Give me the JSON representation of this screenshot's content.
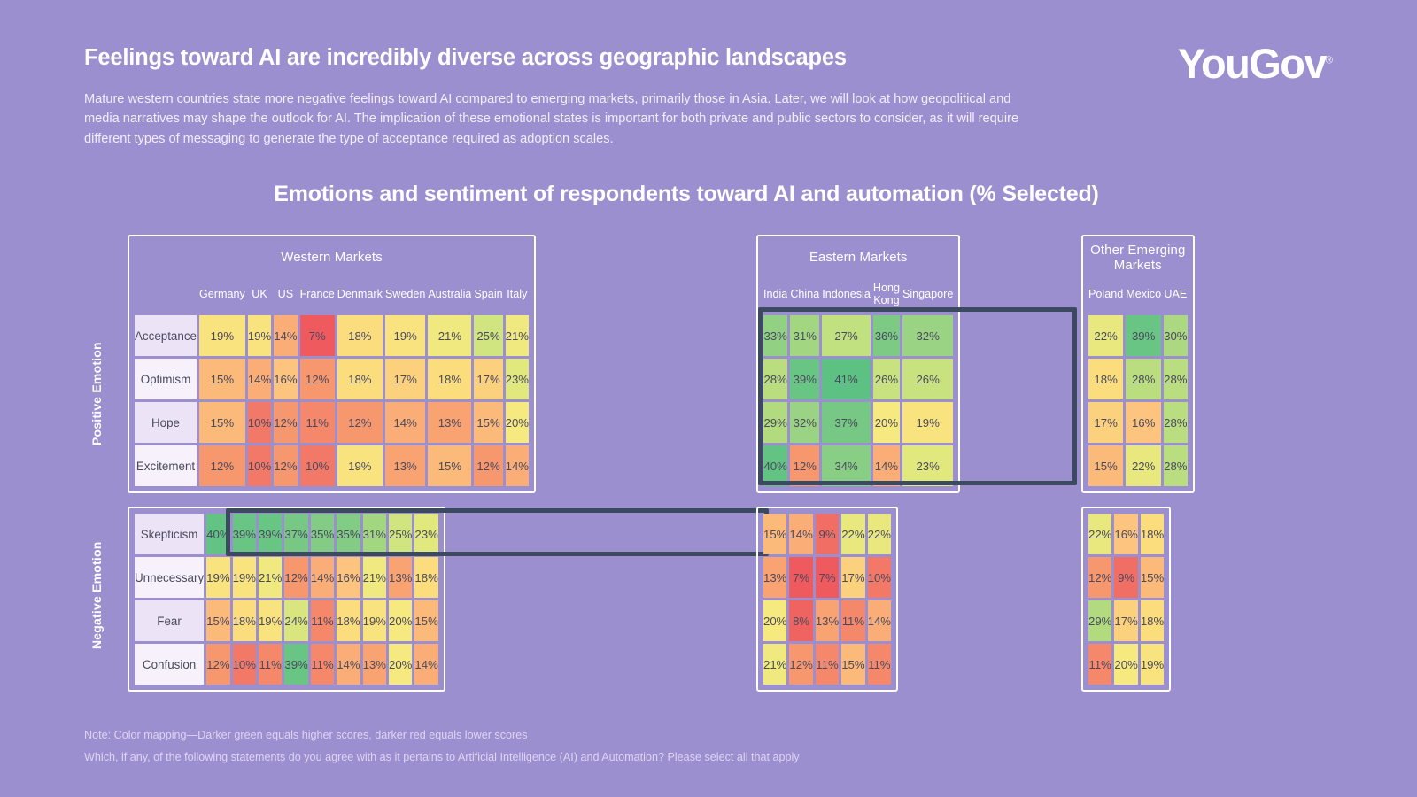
{
  "brand": {
    "logo_text": "YouGov",
    "registered_mark": "®",
    "background_color": "#9c8fcf",
    "accent_highlight_color": "#3b4a5e"
  },
  "header": {
    "title": "Feelings toward AI are incredibly diverse across geographic landscapes",
    "body": "Mature western countries state more negative feelings toward AI compared to emerging markets, primarily those in Asia. Later, we will look at how geopolitical and media narratives may shape the outlook for AI. The implication of these emotional states is important for both private and public sectors to consider, as it will require different types of messaging to generate the type of acceptance required as adoption scales."
  },
  "chart_title": "Emotions and sentiment of respondents toward AI and automation (% Selected)",
  "axis_labels": {
    "positive": "Positive Emotion",
    "negative": "Negative Emotion"
  },
  "footer": {
    "note": "Note: Color mapping—Darker green equals higher scores, darker red equals lower scores",
    "question": "Which, if any, of the following statements do you agree with as it pertains to Artificial Intelligence (AI) and Automation? Please select all that apply"
  },
  "chart_data": {
    "type": "heatmap",
    "title": "Emotions and sentiment of respondents toward AI and automation (% Selected)",
    "value_suffix": "%",
    "colormap": "red-yellow-green (darker green = higher score, darker red = lower score)",
    "value_domain": [
      7,
      41
    ],
    "positive_rows": [
      "Acceptance",
      "Optimism",
      "Hope",
      "Excitement"
    ],
    "negative_rows": [
      "Skepticism",
      "Unnecessary",
      "Fear",
      "Confusion"
    ],
    "groups": [
      {
        "name": "Western Markets",
        "countries": [
          "Germany",
          "UK",
          "US",
          "France",
          "Denmark",
          "Sweden",
          "Australia",
          "Spain",
          "Italy"
        ],
        "positive": [
          [
            19,
            19,
            14,
            7,
            18,
            19,
            21,
            25,
            21
          ],
          [
            15,
            14,
            16,
            12,
            18,
            17,
            18,
            17,
            23
          ],
          [
            15,
            10,
            12,
            11,
            12,
            14,
            13,
            15,
            20
          ],
          [
            12,
            10,
            12,
            10,
            19,
            13,
            15,
            12,
            14
          ]
        ],
        "negative": [
          [
            40,
            39,
            39,
            37,
            35,
            35,
            31,
            25,
            23
          ],
          [
            19,
            19,
            21,
            12,
            14,
            16,
            21,
            13,
            18
          ],
          [
            15,
            18,
            19,
            24,
            11,
            18,
            19,
            20,
            15
          ],
          [
            12,
            10,
            11,
            39,
            11,
            14,
            13,
            20,
            14
          ]
        ],
        "highlight": {
          "section": "negative",
          "rows": [
            0
          ]
        }
      },
      {
        "name": "Eastern Markets",
        "countries": [
          "India",
          "China",
          "Indonesia",
          "Hong Kong",
          "Singapore"
        ],
        "positive": [
          [
            33,
            31,
            27,
            36,
            32
          ],
          [
            28,
            39,
            41,
            26,
            26
          ],
          [
            29,
            32,
            37,
            20,
            19
          ],
          [
            40,
            12,
            34,
            14,
            23
          ]
        ],
        "negative": [
          [
            15,
            14,
            9,
            22,
            22
          ],
          [
            13,
            7,
            7,
            17,
            10
          ],
          [
            20,
            8,
            13,
            11,
            14
          ],
          [
            21,
            12,
            11,
            15,
            11
          ]
        ],
        "highlight": {
          "section": "positive",
          "rows": [
            0,
            1,
            2,
            3
          ]
        }
      },
      {
        "name": "Other Emerging Markets",
        "countries": [
          "Poland",
          "Mexico",
          "UAE"
        ],
        "positive": [
          [
            22,
            39,
            30
          ],
          [
            18,
            28,
            28
          ],
          [
            17,
            16,
            28
          ],
          [
            15,
            22,
            28
          ]
        ],
        "negative": [
          [
            22,
            16,
            18
          ],
          [
            12,
            9,
            15
          ],
          [
            29,
            17,
            18
          ],
          [
            11,
            20,
            19
          ]
        ],
        "highlight": null
      }
    ]
  }
}
